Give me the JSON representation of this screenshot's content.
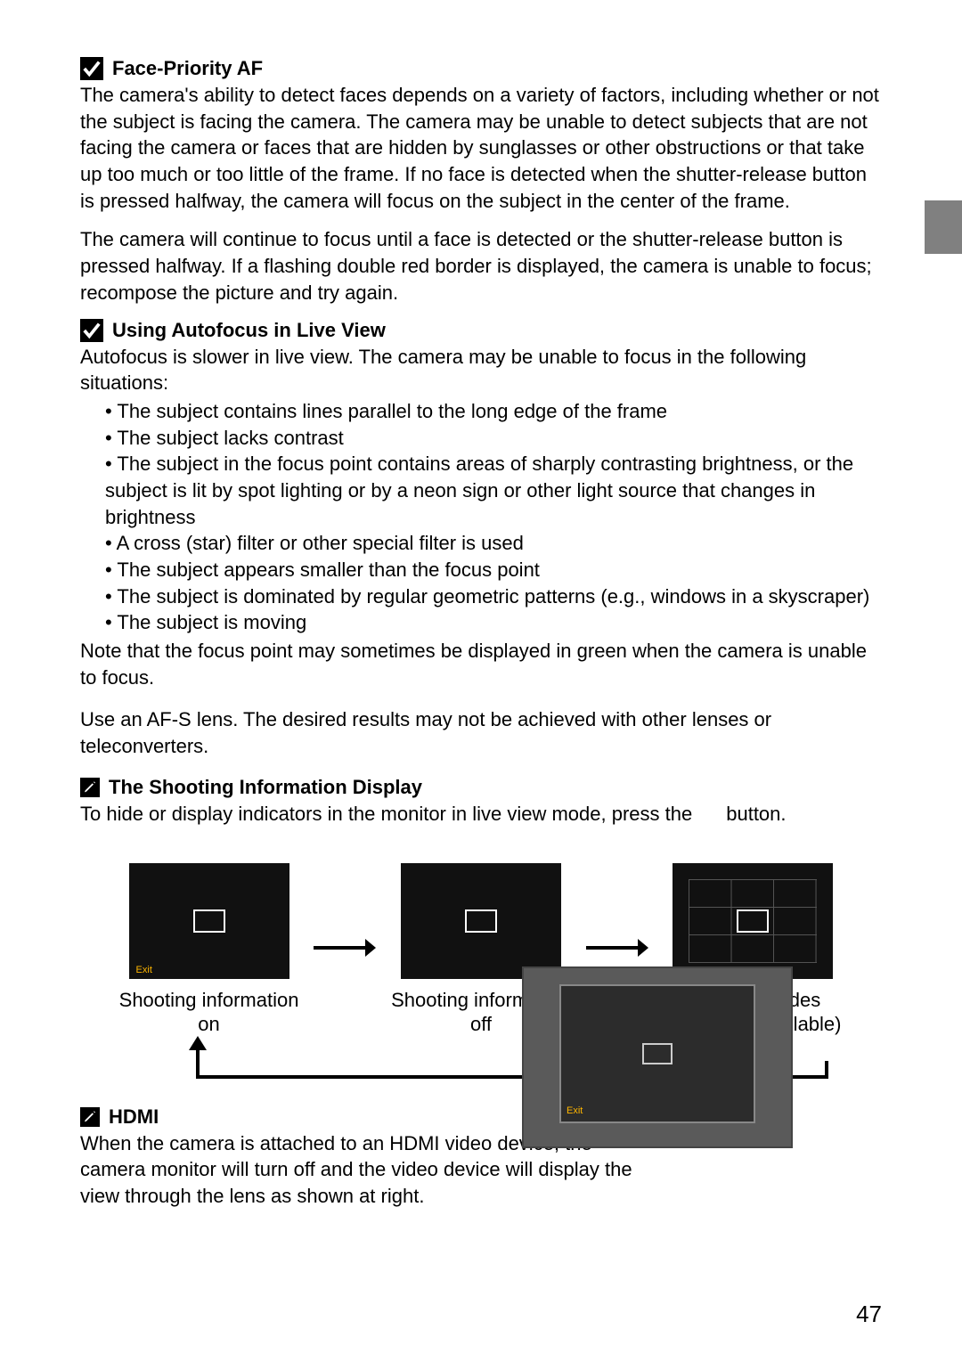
{
  "side_tab": {
    "icon": "bird-icon"
  },
  "page_number": "47",
  "section1": {
    "title": "Face-Priority AF",
    "p1": "The camera's ability to detect faces depends on a variety of factors, including whether or not the subject is facing the camera. The camera may be unable to detect subjects that are not facing the camera or faces that are hidden by sunglasses or other obstructions or that take up too much or too little of the frame. If no face is detected when the shutter-release button is pressed halfway, the camera will focus on the subject in the center of the frame.",
    "p2": "The camera will continue to focus until a face is detected or the shutter-release button is pressed halfway. If a flashing double red border is displayed, the camera is unable to focus; recompose the picture and try again."
  },
  "section2": {
    "title": "Using Autofocus in Live View",
    "intro": "Autofocus is slower in live view. The camera may be unable to focus in the following situations:",
    "bullets": [
      "The subject contains lines parallel to the long edge of the frame",
      "The subject lacks contrast",
      "The subject in the focus point contains areas of sharply contrasting brightness, or the subject is lit by spot lighting or by a neon sign or other light source that changes in brightness",
      "A cross (star) filter or other special filter is used",
      "The subject appears smaller than the focus point",
      "The subject is dominated by regular geometric patterns (e.g., windows in a skyscraper)",
      "The subject is moving"
    ],
    "note": "Note that the focus point may sometimes be displayed in green when the camera is unable to focus.",
    "useaf": "Use an AF-S lens. The desired results may not be achieved with other lenses or teleconverters."
  },
  "section3": {
    "title": "The Shooting Information Display",
    "line_pre": "To hide or display indicators in the monitor in live view mode, press the",
    "line_post": "button.",
    "exit_label": "Exit",
    "captions": {
      "on": "Shooting information\non",
      "off": "Shooting information\noff",
      "grid": "Framing guides\n(zoom not available)"
    }
  },
  "section4": {
    "title": "HDMI",
    "body": "When the camera is attached to an HDMI video device, the camera monitor will turn off and the video device will display the view through the lens as shown at right.",
    "exit_label": "Exit"
  }
}
